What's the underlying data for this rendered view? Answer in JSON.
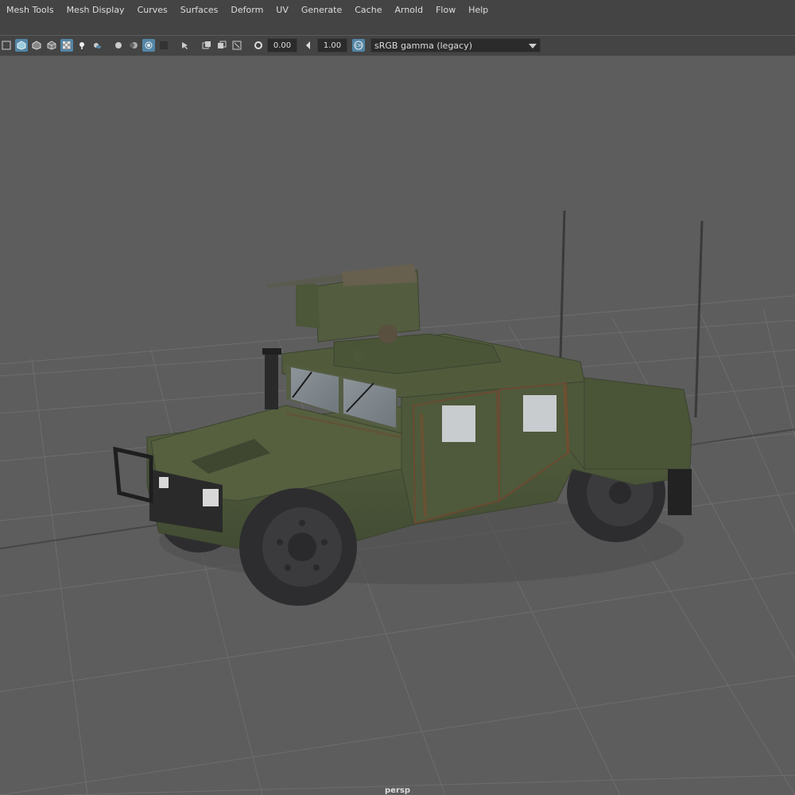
{
  "menu": [
    "Mesh Tools",
    "Mesh Display",
    "Curves",
    "Surfaces",
    "Deform",
    "UV",
    "Generate",
    "Cache",
    "Arnold",
    "Flow",
    "Help"
  ],
  "toolbar": {
    "exposure_value": "0.00",
    "gamma_value": "1.00",
    "color_space": "sRGB gamma (legacy)"
  },
  "icons": [
    "wireframe-icon",
    "smooth-shade-icon",
    "wireframe-on-shaded-icon",
    "textured-icon",
    "xray-icon",
    "light-icon",
    "shadow-icon",
    "ao-icon",
    "motion-blur-icon",
    "isolate-icon",
    "camera-gate-icon",
    "resolution-gate-icon",
    "grid-icon",
    "exposure-icon",
    "gamma-icon",
    "color-management-icon"
  ],
  "viewport": {
    "camera_label": "persp"
  },
  "colors": {
    "viewport_bg": "#5d5d5d",
    "vehicle_body": "#4e5a3b",
    "accent_blue": "#5285a6"
  }
}
